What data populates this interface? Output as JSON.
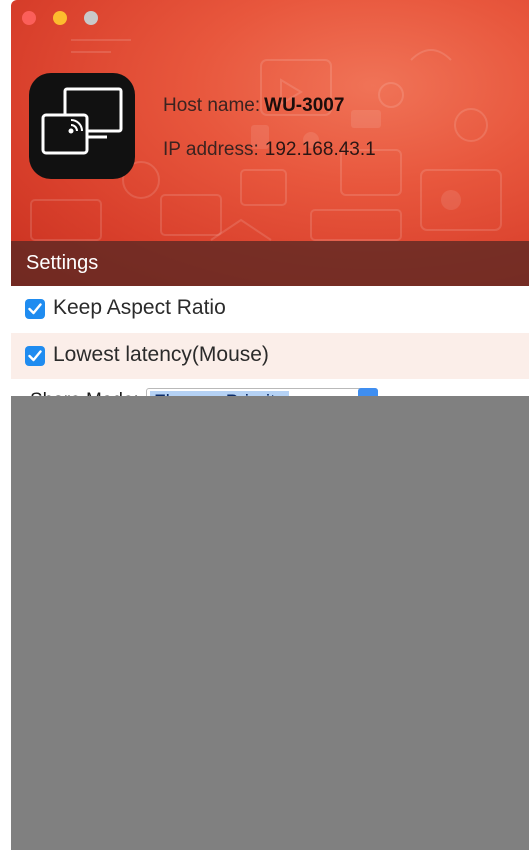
{
  "window": {
    "controls": [
      "close",
      "minimize",
      "maximize"
    ]
  },
  "header": {
    "app_icon": "screen-mirror-icon",
    "host_label": "Host name:",
    "host_value": "WU-3007",
    "ip_label": "IP address:",
    "ip_value": "192.168.43.1",
    "accent_color": "#e8573d"
  },
  "settings": {
    "title": "Settings",
    "options": [
      {
        "label": "Keep Aspect Ratio",
        "checked": true
      },
      {
        "label": "Lowest latency(Mouse)",
        "checked": true
      }
    ],
    "share_mode": {
      "label": "Share Mode:",
      "value": "Fluency Priority"
    }
  }
}
